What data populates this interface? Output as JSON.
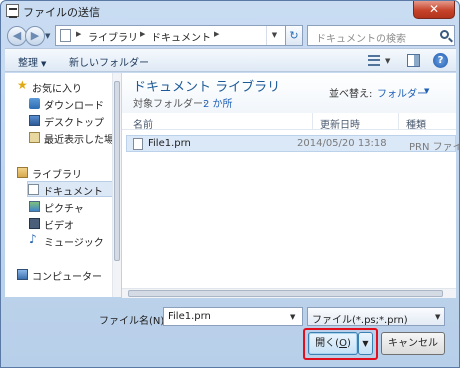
{
  "window": {
    "title": "ファイルの送信",
    "close_label": "✕"
  },
  "nav": {
    "back_glyph": "◀",
    "forward_glyph": "▶",
    "address_segments": [
      "ライブラリ",
      "ドキュメント"
    ],
    "refresh_glyph": "↻",
    "search_placeholder": "ドキュメントの検索"
  },
  "toolbar": {
    "organize_label": "整理",
    "new_folder_label": "新しいフォルダー"
  },
  "sidebar": {
    "favorites": {
      "label": "お気に入り",
      "items": [
        "ダウンロード",
        "デスクトップ",
        "最近表示した場所"
      ]
    },
    "libraries": {
      "label": "ライブラリ",
      "items": [
        "ドキュメント",
        "ピクチャ",
        "ビデオ",
        "ミュージック"
      ]
    },
    "computer_label": "コンピューター"
  },
  "main": {
    "title": "ドキュメント ライブラリ",
    "subtitle_prefix": "対象フォルダー:",
    "subtitle_link": "2 か所",
    "sort_label": "並べ替え:",
    "sort_value": "フォルダー",
    "columns": [
      "名前",
      "更新日時",
      "種類"
    ],
    "files": [
      {
        "name": "File1.prn",
        "modified": "2014/05/20 13:18",
        "type": "PRN ファイル"
      }
    ]
  },
  "footer": {
    "filename_label": "ファイル名(N):",
    "filename_value": "File1.prn",
    "filetype_value": "ファイル(*.ps;*.prn)",
    "open_label_prefix": "開く(",
    "open_label_key": "O",
    "open_label_suffix": ")",
    "cancel_label": "キャンセル"
  },
  "colors": {
    "highlight_box": "#e0101e",
    "link": "#1f5fb5",
    "library_title": "#1e5a96"
  }
}
